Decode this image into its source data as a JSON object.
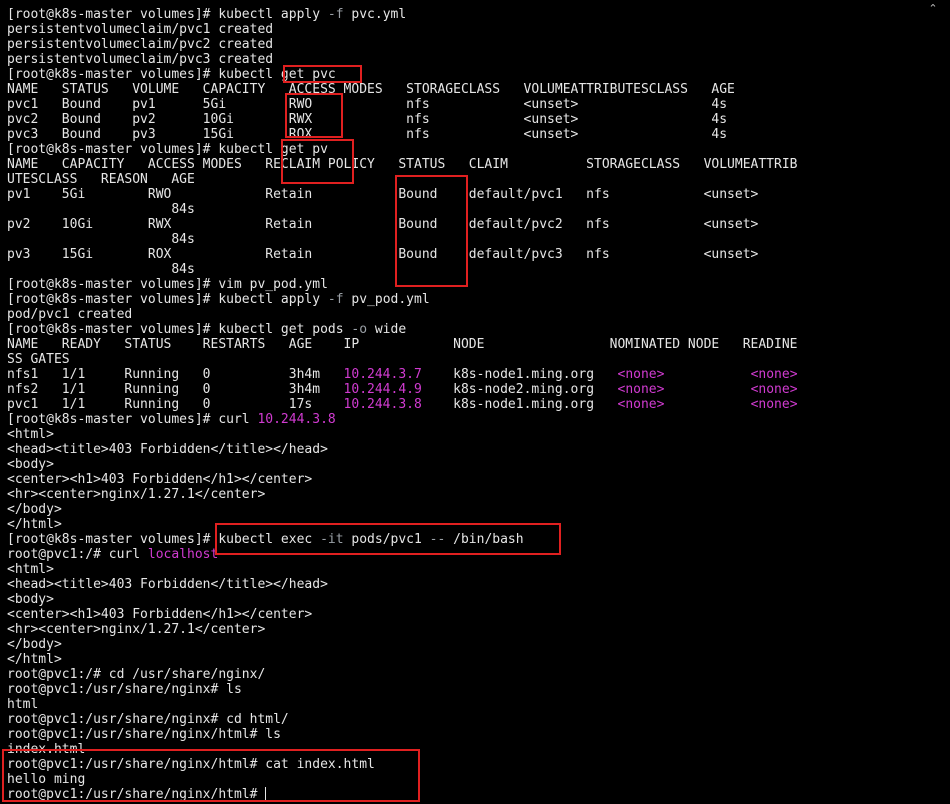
{
  "colors": {
    "background": "#000000",
    "text": "#e6e6e6",
    "dim": "#9aa0a6",
    "magenta": "#d13bd1",
    "highlight_box": "#e02020"
  },
  "icons": {
    "scroll_up": "chevron-up-icon"
  },
  "scroll_glyph": "⌃",
  "cursor_glyph": "|",
  "terminal": {
    "lines": [
      [
        {
          "t": "[root@k8s-master volumes]# kubectl apply "
        },
        {
          "t": "-f",
          "c": "dim"
        },
        {
          "t": " pvc.yml"
        }
      ],
      [
        {
          "t": "persistentvolumeclaim/pvc1 created"
        }
      ],
      [
        {
          "t": "persistentvolumeclaim/pvc2 created"
        }
      ],
      [
        {
          "t": "persistentvolumeclaim/pvc3 created"
        }
      ],
      [
        {
          "t": "[root@k8s-master volumes]# kubectl get pvc"
        }
      ],
      [
        {
          "t": "NAME   STATUS   VOLUME   CAPACITY   ACCESS MODES   STORAGECLASS   VOLUMEATTRIBUTESCLASS   AGE"
        }
      ],
      [
        {
          "t": "pvc1   Bound    pv1      5Gi        RWO            nfs            <unset>                 4s"
        }
      ],
      [
        {
          "t": "pvc2   Bound    pv2      10Gi       RWX            nfs            <unset>                 4s"
        }
      ],
      [
        {
          "t": "pvc3   Bound    pv3      15Gi       ROX            nfs            <unset>                 4s"
        }
      ],
      [
        {
          "t": "[root@k8s-master volumes]# kubectl get pv"
        }
      ],
      [
        {
          "t": "NAME   CAPACITY   ACCESS MODES   RECLAIM POLICY   STATUS   CLAIM          STORAGECLASS   VOLUMEATTRIB"
        }
      ],
      [
        {
          "t": "UTESCLASS   REASON   AGE"
        }
      ],
      [
        {
          "t": "pv1    5Gi        RWO            Retain           Bound    default/pvc1   nfs            <unset>"
        }
      ],
      [
        {
          "t": "                     84s"
        }
      ],
      [
        {
          "t": "pv2    10Gi       RWX            Retain           Bound    default/pvc2   nfs            <unset>"
        }
      ],
      [
        {
          "t": "                     84s"
        }
      ],
      [
        {
          "t": "pv3    15Gi       ROX            Retain           Bound    default/pvc3   nfs            <unset>"
        }
      ],
      [
        {
          "t": "                     84s"
        }
      ],
      [
        {
          "t": "[root@k8s-master volumes]# vim pv_pod.yml"
        }
      ],
      [
        {
          "t": "[root@k8s-master volumes]# kubectl apply "
        },
        {
          "t": "-f",
          "c": "dim"
        },
        {
          "t": " pv_pod.yml"
        }
      ],
      [
        {
          "t": "pod/pvc1 created"
        }
      ],
      [
        {
          "t": "[root@k8s-master volumes]# kubectl get pods "
        },
        {
          "t": "-o",
          "c": "dim"
        },
        {
          "t": " wide"
        }
      ],
      [
        {
          "t": "NAME   READY   STATUS    RESTARTS   AGE    IP            NODE                NOMINATED NODE   READINE"
        }
      ],
      [
        {
          "t": "SS GATES"
        }
      ],
      [
        {
          "t": "nfs1   1/1     Running   0          3h4m   "
        },
        {
          "t": "10.244.3.7",
          "c": "magenta"
        },
        {
          "t": "    k8s-node1.ming.org   "
        },
        {
          "t": "<none>",
          "c": "magenta"
        },
        {
          "t": "           "
        },
        {
          "t": "<none>",
          "c": "magenta"
        }
      ],
      [
        {
          "t": "nfs2   1/1     Running   0          3h4m   "
        },
        {
          "t": "10.244.4.9",
          "c": "magenta"
        },
        {
          "t": "    k8s-node2.ming.org   "
        },
        {
          "t": "<none>",
          "c": "magenta"
        },
        {
          "t": "           "
        },
        {
          "t": "<none>",
          "c": "magenta"
        }
      ],
      [
        {
          "t": "pvc1   1/1     Running   0          17s    "
        },
        {
          "t": "10.244.3.8",
          "c": "magenta"
        },
        {
          "t": "    k8s-node1.ming.org   "
        },
        {
          "t": "<none>",
          "c": "magenta"
        },
        {
          "t": "           "
        },
        {
          "t": "<none>",
          "c": "magenta"
        }
      ],
      [
        {
          "t": "[root@k8s-master volumes]# curl "
        },
        {
          "t": "10.244.3.8",
          "c": "magenta"
        }
      ],
      [
        {
          "t": "<html>"
        }
      ],
      [
        {
          "t": "<head><title>403 Forbidden</title></head>"
        }
      ],
      [
        {
          "t": "<body>"
        }
      ],
      [
        {
          "t": "<center><h1>403 Forbidden</h1></center>"
        }
      ],
      [
        {
          "t": "<hr><center>nginx/1.27.1</center>"
        }
      ],
      [
        {
          "t": "</body>"
        }
      ],
      [
        {
          "t": "</html>"
        }
      ],
      [
        {
          "t": "[root@k8s-master volumes]# kubectl exec "
        },
        {
          "t": "-it",
          "c": "dim"
        },
        {
          "t": " pods/pvc1 "
        },
        {
          "t": "--",
          "c": "dim"
        },
        {
          "t": " /bin/bash"
        }
      ],
      [
        {
          "t": "root@pvc1:/# curl "
        },
        {
          "t": "localhost",
          "c": "magenta"
        }
      ],
      [
        {
          "t": "<html>"
        }
      ],
      [
        {
          "t": "<head><title>403 Forbidden</title></head>"
        }
      ],
      [
        {
          "t": "<body>"
        }
      ],
      [
        {
          "t": "<center><h1>403 Forbidden</h1></center>"
        }
      ],
      [
        {
          "t": "<hr><center>nginx/1.27.1</center>"
        }
      ],
      [
        {
          "t": "</body>"
        }
      ],
      [
        {
          "t": "</html>"
        }
      ],
      [
        {
          "t": "root@pvc1:/# cd /usr/share/nginx/"
        }
      ],
      [
        {
          "t": "root@pvc1:/usr/share/nginx# ls"
        }
      ],
      [
        {
          "t": "html"
        }
      ],
      [
        {
          "t": "root@pvc1:/usr/share/nginx# cd html/"
        }
      ],
      [
        {
          "t": "root@pvc1:/usr/share/nginx/html# ls"
        }
      ],
      [
        {
          "t": "index.html"
        }
      ],
      [
        {
          "t": "root@pvc1:/usr/share/nginx/html# cat index.html"
        }
      ],
      [
        {
          "t": "hello ming"
        }
      ],
      [
        {
          "t": "root@pvc1:/usr/share/nginx/html# "
        }
      ]
    ]
  }
}
